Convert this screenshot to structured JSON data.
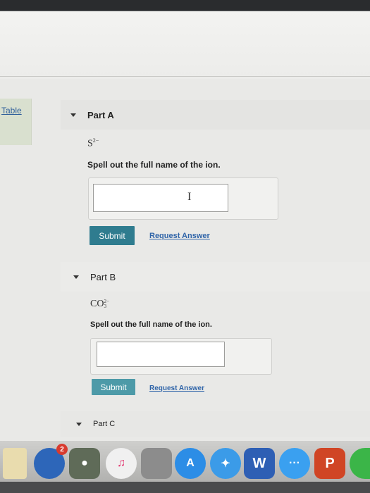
{
  "sidebar": {
    "table_link": "Table"
  },
  "partA": {
    "title": "Part A",
    "ion_base": "S",
    "ion_charge": "2−",
    "instruction": "Spell out the full name of the ion.",
    "answer_value": "",
    "submit": "Submit",
    "request": "Request Answer"
  },
  "partB": {
    "title": "Part B",
    "ion_base": "CO",
    "ion_charge": "2−",
    "ion_subscript": "3",
    "instruction": "Spell out the full name of the ion.",
    "answer_value": "",
    "submit": "Submit",
    "request": "Request Answer"
  },
  "partC": {
    "title": "Part C"
  },
  "dock": {
    "icons": [
      "finder-icon",
      "launchpad-icon",
      "itunes-icon",
      "photo-icon",
      "app-store-icon",
      "safari-icon",
      "word-icon",
      "messages-icon",
      "powerpoint-icon",
      "facetime-icon"
    ],
    "notification_badge": "2"
  }
}
